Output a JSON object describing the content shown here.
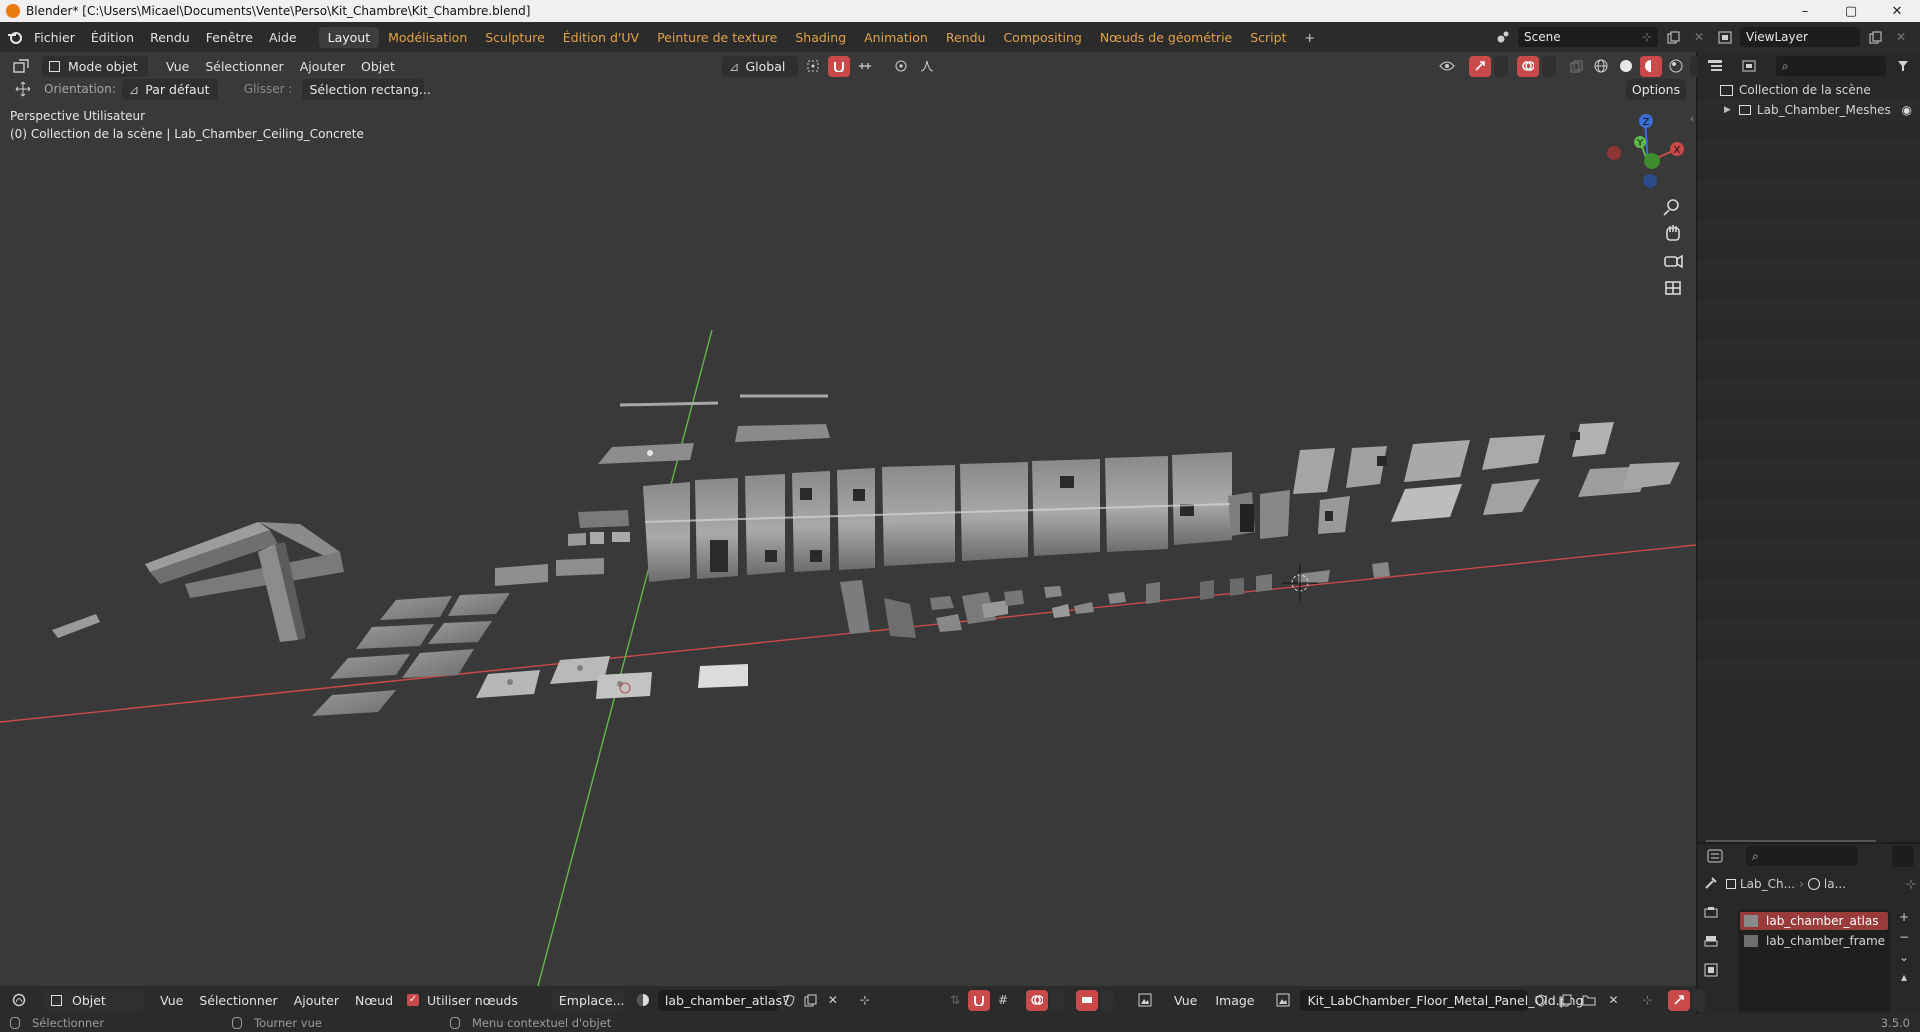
{
  "window": {
    "title": "Blender* [C:\\Users\\Micael\\Documents\\Vente\\Perso\\Kit_Chambre\\Kit_Chambre.blend]",
    "controls": [
      "–",
      "▢",
      "✕"
    ]
  },
  "menu": [
    "Fichier",
    "Édition",
    "Rendu",
    "Fenêtre",
    "Aide"
  ],
  "workspaces": [
    "Layout",
    "Modélisation",
    "Sculpture",
    "Édition d'UV",
    "Peinture de texture",
    "Shading",
    "Animation",
    "Rendu",
    "Compositing",
    "Nœuds de géométrie",
    "Script"
  ],
  "active_workspace": "Layout",
  "workspace_add": "+",
  "scene": {
    "label": "Scene",
    "view_layer": "ViewLayer"
  },
  "viewport_header": {
    "mode": "Mode objet",
    "menus": [
      "Vue",
      "Sélectionner",
      "Ajouter",
      "Objet"
    ],
    "transform_orientation": "Global",
    "options": "Options"
  },
  "tool_options": {
    "orientation_label": "Orientation:",
    "orientation_value": "Par défaut",
    "drag_label": "Glisser :",
    "drag_value": "Sélection rectang..."
  },
  "viewport": {
    "perspective": "Perspective Utilisateur",
    "context": "(0) Collection de la scène | Lab_Chamber_Ceiling_Concrete",
    "gizmo": {
      "x": "X",
      "y": "Y",
      "z": "Z"
    },
    "colors": {
      "x_axis": "#c94a4a",
      "y_axis": "#5fb84a",
      "z_axis": "#3b6fd6",
      "background": "#393939"
    }
  },
  "outliner": {
    "root": "Collection de la scène",
    "items": [
      {
        "label": "Lab_Chamber_Meshes"
      }
    ]
  },
  "properties": {
    "breadcrumb": [
      "Lab_Ch...",
      "la..."
    ],
    "materials": [
      "lab_chamber_atlas",
      "lab_chamber_frame"
    ],
    "selected_material": "lab_chamber_atlas",
    "accent": "#9a3b3b"
  },
  "image_editor_header": {
    "mode": "Objet",
    "menus": [
      "Vue",
      "Sélectionner",
      "Ajouter",
      "Nœud"
    ],
    "use_nodes_label": "Utiliser nœuds",
    "slot": "Emplace...",
    "material": "lab_chamber_atlas",
    "material_users": "7",
    "image_menus": [
      "Vue",
      "Image"
    ],
    "image_name": "Kit_LabChamber_Floor_Metal_Panel_Old.png"
  },
  "statusbar": {
    "select": "Sélectionner",
    "rotate": "Tourner vue",
    "context_menu": "Menu contextuel d'objet",
    "version": "3.5.0"
  }
}
